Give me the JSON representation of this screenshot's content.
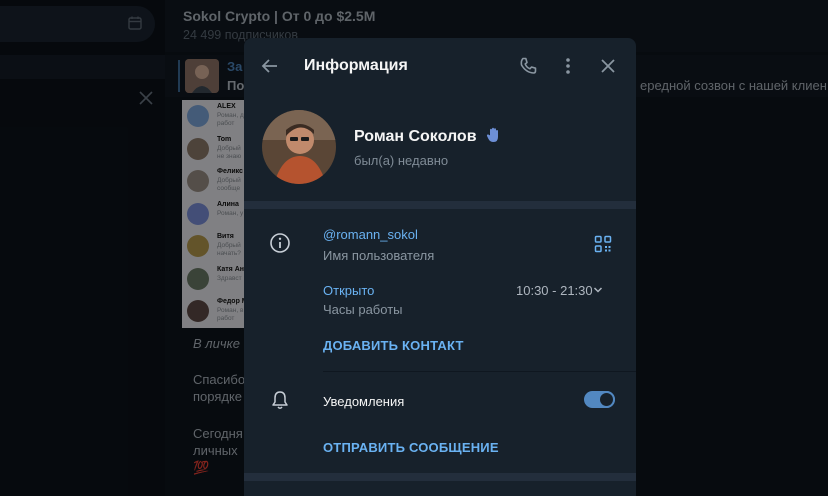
{
  "background": {
    "chat": {
      "title": "Sokol Crypto | От 0 до $2.5M",
      "subscribers": "24 499 подписчиков"
    },
    "pinned": {
      "title": "За",
      "text": "По",
      "right_text": "ередной созвон с нашей клиен"
    },
    "screenshot_contacts": [
      {
        "name": "ALEX",
        "preview": "Роман, да\nработ",
        "color": "#7da7db"
      },
      {
        "name": "Tom",
        "preview": "Добрый\nне знаю",
        "color": "#8d7a6b"
      },
      {
        "name": "Феликс",
        "preview": "Добрый\nсообще",
        "color": "#9a8f86"
      },
      {
        "name": "Алина",
        "preview": "Роман, у",
        "color": "#7b8fd9"
      },
      {
        "name": "Витя",
        "preview": "Добрый\nначать?",
        "color": "#b59a4e"
      },
      {
        "name": "Катя Ане",
        "preview": "Здравст",
        "color": "#6a7a66"
      },
      {
        "name": "Федор М",
        "preview": "Роман, в\nработ",
        "color": "#5e4a45"
      }
    ],
    "messages": [
      {
        "text": "В личке -",
        "italic": true
      },
      {
        "text": "Спасибо",
        "italic": false
      },
      {
        "text": "порядке",
        "italic": false
      },
      {
        "text": "Сегодня",
        "italic": false
      },
      {
        "text": "личных",
        "italic": false
      },
      {
        "text": "💯",
        "italic": false
      }
    ]
  },
  "modal": {
    "title": "Информация",
    "profile": {
      "name": "Роман Соколов",
      "status": "был(а) недавно"
    },
    "username": {
      "value": "@romann_sokol",
      "label": "Имя пользователя"
    },
    "hours": {
      "status": "Открыто",
      "range": "10:30 - 21:30",
      "label": "Часы работы"
    },
    "add_contact": "ДОБАВИТЬ КОНТАКТ",
    "notifications": {
      "label": "Уведомления",
      "enabled": true
    },
    "send_message": "ОТПРАВИТЬ СООБЩЕНИЕ"
  },
  "colors": {
    "accent": "#6ab2f2",
    "toggle": "#5288c1",
    "modal_bg": "#17212b",
    "separator": "#232e3c"
  },
  "icons": [
    "calendar-icon",
    "close-icon",
    "back-arrow-icon",
    "phone-icon",
    "more-vertical-icon",
    "wave-hand-icon",
    "info-icon",
    "qr-code-icon",
    "chevron-down-icon",
    "bell-icon"
  ]
}
